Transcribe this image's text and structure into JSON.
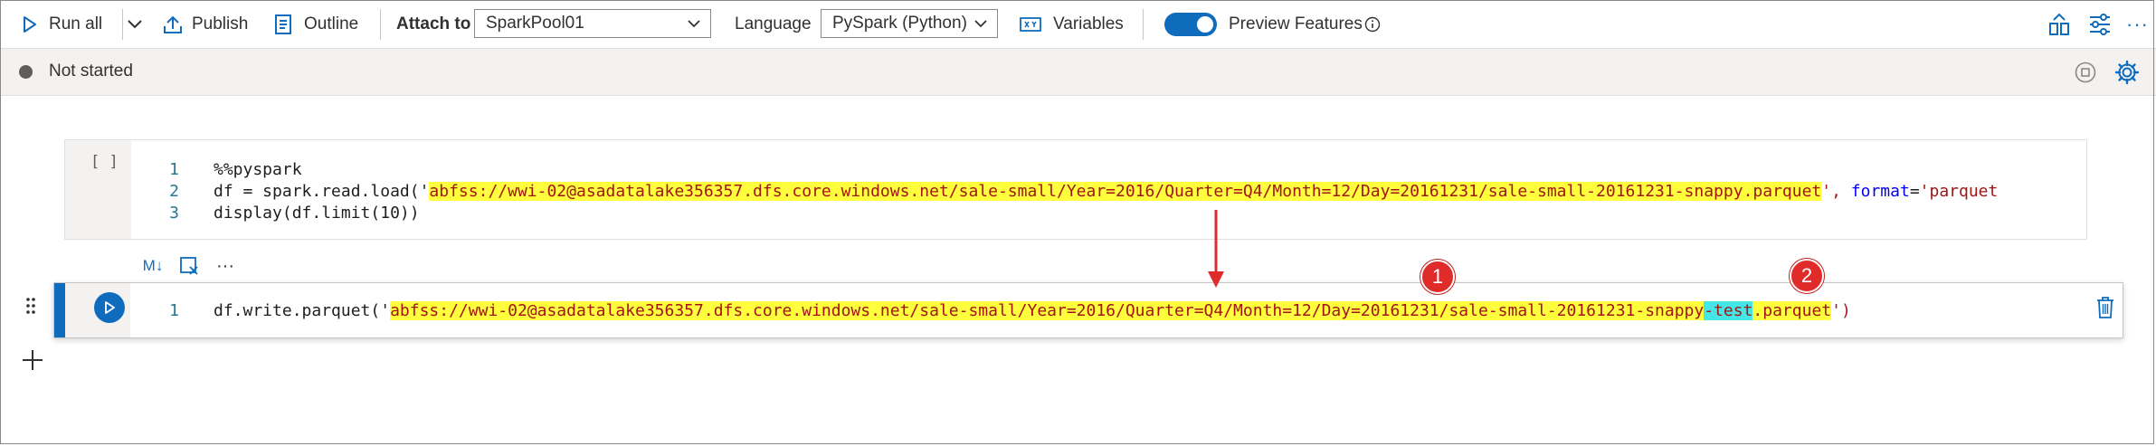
{
  "toolbar": {
    "run_all": "Run all",
    "publish": "Publish",
    "outline": "Outline",
    "attach_to_label": "Attach to",
    "attach_to_value": "SparkPool01",
    "language_label": "Language",
    "language_value": "PySpark (Python)",
    "variables": "Variables",
    "preview_features": "Preview Features",
    "preview_enabled": true
  },
  "status": {
    "text": "Not started"
  },
  "cells": [
    {
      "exec_label": "[ ]",
      "lines": [
        {
          "num": "1",
          "text": "%%pyspark"
        },
        {
          "num": "2",
          "prefix": "df = spark.read.load('",
          "path": "abfss://wwi-02@asadatalake356357.dfs.core.windows.net/sale-small/Year=2016/Quarter=Q4/Month=12/Day=20161231/sale-small-20161231-snappy.parquet",
          "suffix_a": "', ",
          "kwarg": "format",
          "suffix_b": "=",
          "suffix_c": "'parquet"
        },
        {
          "num": "3",
          "text": "display(df.limit(10))"
        }
      ]
    },
    {
      "toolbar": {
        "md": "M↓",
        "more": "···"
      },
      "lines": [
        {
          "num": "1",
          "prefix": "df.write.parquet('",
          "path_a": "abfss://wwi-02@asadatalake356357.dfs.core.windows.net/sale-small/Year=2016/Quarter=Q4/Month=12/Day=20161231/sale-small-20161231-snappy",
          "path_b": "-test",
          "path_c": ".parquet",
          "suffix": "')"
        }
      ]
    }
  ],
  "annotations": {
    "badge1": "1",
    "badge2": "2",
    "arrow_color": "#e02b2b"
  },
  "colors": {
    "accent": "#0f6cbd",
    "highlight": "#ffff3d",
    "highlight_alt": "#44e6e6",
    "string": "#a31515",
    "keyword": "#0000ff",
    "line_number": "#237893"
  }
}
